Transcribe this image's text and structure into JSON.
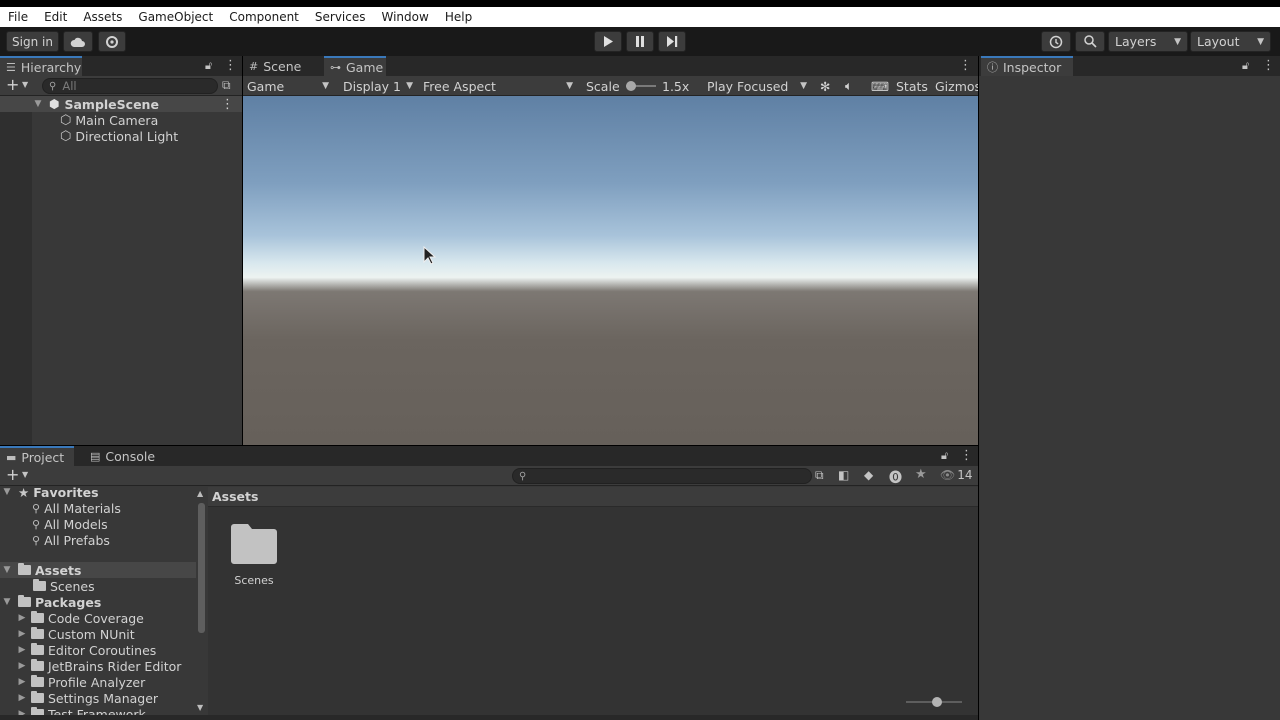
{
  "menu": [
    "File",
    "Edit",
    "Assets",
    "GameObject",
    "Component",
    "Services",
    "Window",
    "Help"
  ],
  "toolbar": {
    "sign_in": "Sign in",
    "layers": "Layers",
    "layout": "Layout"
  },
  "hierarchy": {
    "tab": "Hierarchy",
    "search_placeholder": "All",
    "scene": "SampleScene",
    "items": [
      "Main Camera",
      "Directional Light"
    ]
  },
  "game": {
    "tabs": [
      "Scene",
      "Game"
    ],
    "mode": "Game",
    "display": "Display 1",
    "aspect": "Free Aspect",
    "scale_label": "Scale",
    "scale_value": "1.5x",
    "play_mode": "Play Focused",
    "stats": "Stats",
    "gizmos": "Gizmos"
  },
  "inspector": {
    "tab": "Inspector"
  },
  "project": {
    "tabs": [
      "Project",
      "Console"
    ],
    "hidden_count": "14",
    "favorites": {
      "label": "Favorites",
      "items": [
        "All Materials",
        "All Models",
        "All Prefabs"
      ]
    },
    "assets": {
      "label": "Assets",
      "items": [
        "Scenes"
      ]
    },
    "packages": {
      "label": "Packages",
      "items": [
        "Code Coverage",
        "Custom NUnit",
        "Editor Coroutines",
        "JetBrains Rider Editor",
        "Profile Analyzer",
        "Settings Manager",
        "Test Framework"
      ]
    },
    "breadcrumb": "Assets",
    "grid_items": [
      "Scenes"
    ]
  },
  "colors": {
    "accent": "#3a79bb",
    "panel": "#383838",
    "toolbar": "#191919"
  }
}
